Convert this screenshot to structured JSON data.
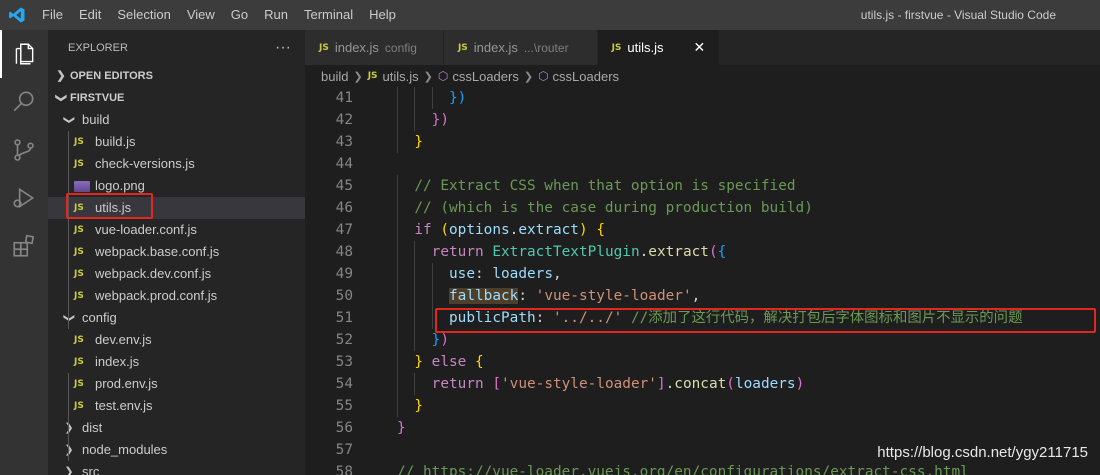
{
  "titlebar": {
    "menu": [
      "File",
      "Edit",
      "Selection",
      "View",
      "Go",
      "Run",
      "Terminal",
      "Help"
    ],
    "window_title": "utils.js - firstvue - Visual Studio Code"
  },
  "activity_bar": {
    "icons": [
      "explorer-icon",
      "search-icon",
      "source-control-icon",
      "run-debug-icon",
      "extensions-icon"
    ]
  },
  "sidebar": {
    "title": "EXPLORER",
    "more": "···",
    "open_editors": "OPEN EDITORS",
    "project": "FIRSTVUE",
    "tree": [
      {
        "label": "build",
        "type": "folder-open",
        "depth": 1
      },
      {
        "label": "build.js",
        "type": "js",
        "depth": 2
      },
      {
        "label": "check-versions.js",
        "type": "js",
        "depth": 2
      },
      {
        "label": "logo.png",
        "type": "image",
        "depth": 2
      },
      {
        "label": "utils.js",
        "type": "js",
        "depth": 2,
        "selected": true
      },
      {
        "label": "vue-loader.conf.js",
        "type": "js",
        "depth": 2
      },
      {
        "label": "webpack.base.conf.js",
        "type": "js",
        "depth": 2
      },
      {
        "label": "webpack.dev.conf.js",
        "type": "js",
        "depth": 2
      },
      {
        "label": "webpack.prod.conf.js",
        "type": "js",
        "depth": 2
      },
      {
        "label": "config",
        "type": "folder-open",
        "depth": 1
      },
      {
        "label": "dev.env.js",
        "type": "js",
        "depth": 2
      },
      {
        "label": "index.js",
        "type": "js",
        "depth": 2
      },
      {
        "label": "prod.env.js",
        "type": "js",
        "depth": 2
      },
      {
        "label": "test.env.js",
        "type": "js",
        "depth": 2
      },
      {
        "label": "dist",
        "type": "folder-closed",
        "depth": 1
      },
      {
        "label": "node_modules",
        "type": "folder-closed",
        "depth": 1
      },
      {
        "label": "src",
        "type": "folder-closed",
        "depth": 1
      }
    ]
  },
  "tabs": [
    {
      "name": "index.js",
      "sub": "config",
      "active": false
    },
    {
      "name": "index.js",
      "sub": "...\\router",
      "active": false
    },
    {
      "name": "utils.js",
      "sub": "",
      "active": true,
      "close": "✕"
    }
  ],
  "js_badge": "JS",
  "breadcrumb": [
    "build",
    "utils.js",
    "cssLoaders",
    "cssLoaders"
  ],
  "code_lines": [
    {
      "n": "41",
      "indent": 3,
      "tokens": [
        [
          "c-br3",
          "})"
        ]
      ]
    },
    {
      "n": "42",
      "indent": 2,
      "tokens": [
        [
          "c-br2",
          "})"
        ]
      ]
    },
    {
      "n": "43",
      "indent": 1,
      "tokens": [
        [
          "c-br1",
          "}"
        ]
      ]
    },
    {
      "n": "44",
      "indent": 0,
      "tokens": []
    },
    {
      "n": "45",
      "indent": 1,
      "tokens": [
        [
          "c-comment",
          "// Extract CSS when that option is specified"
        ]
      ]
    },
    {
      "n": "46",
      "indent": 1,
      "tokens": [
        [
          "c-comment",
          "// (which is the case during production build)"
        ]
      ]
    },
    {
      "n": "47",
      "indent": 1,
      "tokens": [
        [
          "c-kw",
          "if"
        ],
        [
          "c-p",
          " "
        ],
        [
          "c-br1",
          "("
        ],
        [
          "c-var",
          "options"
        ],
        [
          "c-p",
          "."
        ],
        [
          "c-var",
          "extract"
        ],
        [
          "c-br1",
          ")"
        ],
        [
          "c-p",
          " "
        ],
        [
          "c-br1",
          "{"
        ]
      ]
    },
    {
      "n": "48",
      "indent": 2,
      "tokens": [
        [
          "c-kw",
          "return"
        ],
        [
          "c-p",
          " "
        ],
        [
          "c-cls",
          "ExtractTextPlugin"
        ],
        [
          "c-p",
          "."
        ],
        [
          "c-fn",
          "extract"
        ],
        [
          "c-br2",
          "("
        ],
        [
          "c-br3",
          "{"
        ]
      ]
    },
    {
      "n": "49",
      "indent": 3,
      "tokens": [
        [
          "c-var",
          "use"
        ],
        [
          "c-p",
          ": "
        ],
        [
          "c-var",
          "loaders"
        ],
        [
          "c-p",
          ","
        ]
      ]
    },
    {
      "n": "50",
      "indent": 3,
      "tokens": [
        [
          "c-var hl-box",
          "fallback"
        ],
        [
          "c-p",
          ": "
        ],
        [
          "c-str",
          "'vue-style-loader'"
        ],
        [
          "c-p",
          ","
        ]
      ]
    },
    {
      "n": "51",
      "indent": 3,
      "tokens": [
        [
          "c-var",
          "publicPath"
        ],
        [
          "c-p",
          ": "
        ],
        [
          "c-str",
          "'../../'"
        ],
        [
          "c-p",
          " "
        ],
        [
          "c-comment",
          "//添加了这行代码，解决打包后字体图标和图片不显示的问题"
        ]
      ]
    },
    {
      "n": "52",
      "indent": 2,
      "tokens": [
        [
          "c-br3",
          "}"
        ],
        [
          "c-br2",
          ")"
        ]
      ]
    },
    {
      "n": "53",
      "indent": 1,
      "tokens": [
        [
          "c-br1",
          "}"
        ],
        [
          "c-p",
          " "
        ],
        [
          "c-kw",
          "else"
        ],
        [
          "c-p",
          " "
        ],
        [
          "c-br1",
          "{"
        ]
      ]
    },
    {
      "n": "54",
      "indent": 2,
      "tokens": [
        [
          "c-kw",
          "return"
        ],
        [
          "c-p",
          " "
        ],
        [
          "c-br2",
          "["
        ],
        [
          "c-str",
          "'vue-style-loader'"
        ],
        [
          "c-br2",
          "]"
        ],
        [
          "c-p",
          "."
        ],
        [
          "c-fn",
          "concat"
        ],
        [
          "c-br2",
          "("
        ],
        [
          "c-var",
          "loaders"
        ],
        [
          "c-br2",
          ")"
        ]
      ]
    },
    {
      "n": "55",
      "indent": 1,
      "tokens": [
        [
          "c-br1",
          "}"
        ]
      ]
    },
    {
      "n": "56",
      "indent": 0,
      "tokens": [
        [
          "c-br2",
          "}"
        ]
      ]
    },
    {
      "n": "57",
      "indent": 0,
      "tokens": []
    },
    {
      "n": "58",
      "indent": 0,
      "tokens": [
        [
          "c-comment",
          "// https://vue-loader.vuejs.org/en/configurations/extract-css.html"
        ]
      ]
    }
  ],
  "watermark": "https://blog.csdn.net/ygy211715",
  "colors": {
    "accent_red": "#e5261f",
    "js_yellow": "#cbcb41"
  }
}
